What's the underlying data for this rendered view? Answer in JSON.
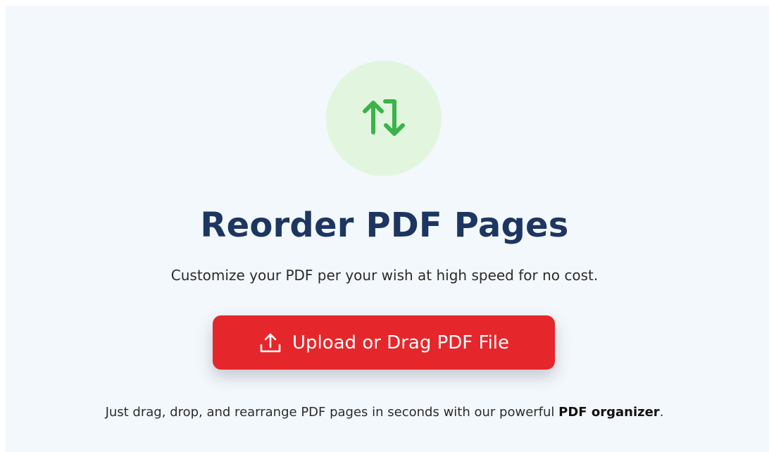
{
  "hero": {
    "icon": "swap-vertical-arrows-icon",
    "icon_color": "#3bb34a",
    "icon_bg_color": "#e2f6df",
    "title": "Reorder PDF Pages",
    "subtitle": "Customize your PDF per your wish at high speed for no cost."
  },
  "upload_button": {
    "icon": "upload-icon",
    "label": "Upload or Drag PDF File",
    "color": "#e5272c"
  },
  "footer": {
    "text": "Just drag, drop, and rearrange PDF pages in seconds with our powerful ",
    "link_text": "PDF organizer",
    "suffix": "."
  }
}
